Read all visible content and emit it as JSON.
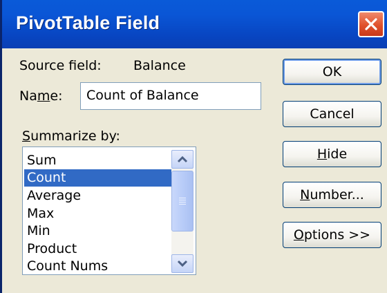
{
  "window": {
    "title": "PivotTable Field"
  },
  "form": {
    "source_field_label": "Source field:",
    "source_field_value": "Balance",
    "name_label_pre": "Na",
    "name_label_mn": "m",
    "name_label_post": "e:",
    "name_value": "Count of Balance",
    "summarize_mn": "S",
    "summarize_post": "ummarize by:"
  },
  "summarize_list": {
    "items": [
      "Sum",
      "Count",
      "Average",
      "Max",
      "Min",
      "Product",
      "Count Nums"
    ],
    "selected": "Count"
  },
  "buttons": {
    "ok": "OK",
    "cancel": "Cancel",
    "hide_mn": "H",
    "hide_post": "ide",
    "number_mn": "N",
    "number_post": "umber...",
    "options_mn": "O",
    "options_post": "ptions >>"
  },
  "colors": {
    "titlebar": "#0a56d6",
    "selection": "#316ac5",
    "dialog_bg": "#ece9d8",
    "close_button": "#e0512c"
  }
}
